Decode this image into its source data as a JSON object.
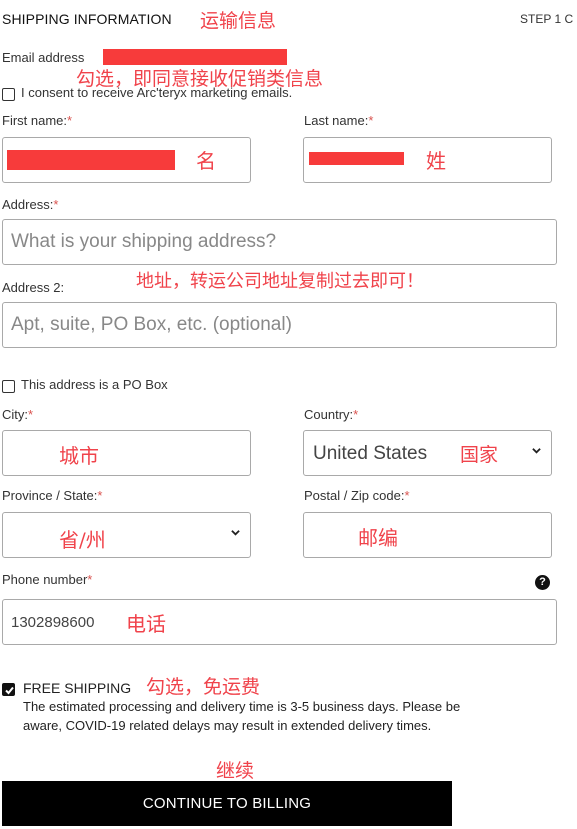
{
  "header": {
    "title": "SHIPPING INFORMATION",
    "title_annotation": "运输信息",
    "step": "STEP 1 C"
  },
  "email": {
    "label": "Email address",
    "value_redacted": true,
    "annotation": "勾选，即同意接收促销类信息"
  },
  "consent": {
    "label": "I consent to receive Arc'teryx marketing emails.",
    "checked": false
  },
  "first_name": {
    "label": "First name:",
    "required_mark": "*",
    "value_redacted": true,
    "annotation": "名"
  },
  "last_name": {
    "label": "Last name:",
    "required_mark": "*",
    "value_redacted": true,
    "annotation": "姓"
  },
  "address": {
    "label": "Address:",
    "required_mark": "*",
    "placeholder": "What is your shipping address?",
    "annotation": "地址，转运公司地址复制过去即可！"
  },
  "address2": {
    "label": "Address 2:",
    "placeholder": "Apt, suite, PO Box, etc. (optional)"
  },
  "po_box": {
    "label": "This address is a PO Box",
    "checked": false
  },
  "city": {
    "label": "City:",
    "required_mark": "*",
    "annotation": "城市"
  },
  "country": {
    "label": "Country:",
    "required_mark": "*",
    "value": "United States",
    "annotation": "国家"
  },
  "state": {
    "label": "Province / State:",
    "required_mark": "*",
    "annotation": "省/州"
  },
  "postal": {
    "label": "Postal / Zip code:",
    "required_mark": "*",
    "annotation": "邮编"
  },
  "phone": {
    "label": "Phone number",
    "required_mark": "*",
    "value": "1302898600",
    "annotation": "电话",
    "help_icon": "?"
  },
  "shipping": {
    "checked": true,
    "label": "FREE SHIPPING",
    "annotation": "勾选，免运费",
    "description": "The estimated processing and delivery time is 3-5 business days. Please be aware, COVID-19 related delays may result in extended delivery times."
  },
  "continue": {
    "annotation": "继续",
    "label": "CONTINUE TO BILLING"
  },
  "colors": {
    "annotation": "#f0434b",
    "redaction": "#f73b3b",
    "button_bg": "#000000"
  }
}
